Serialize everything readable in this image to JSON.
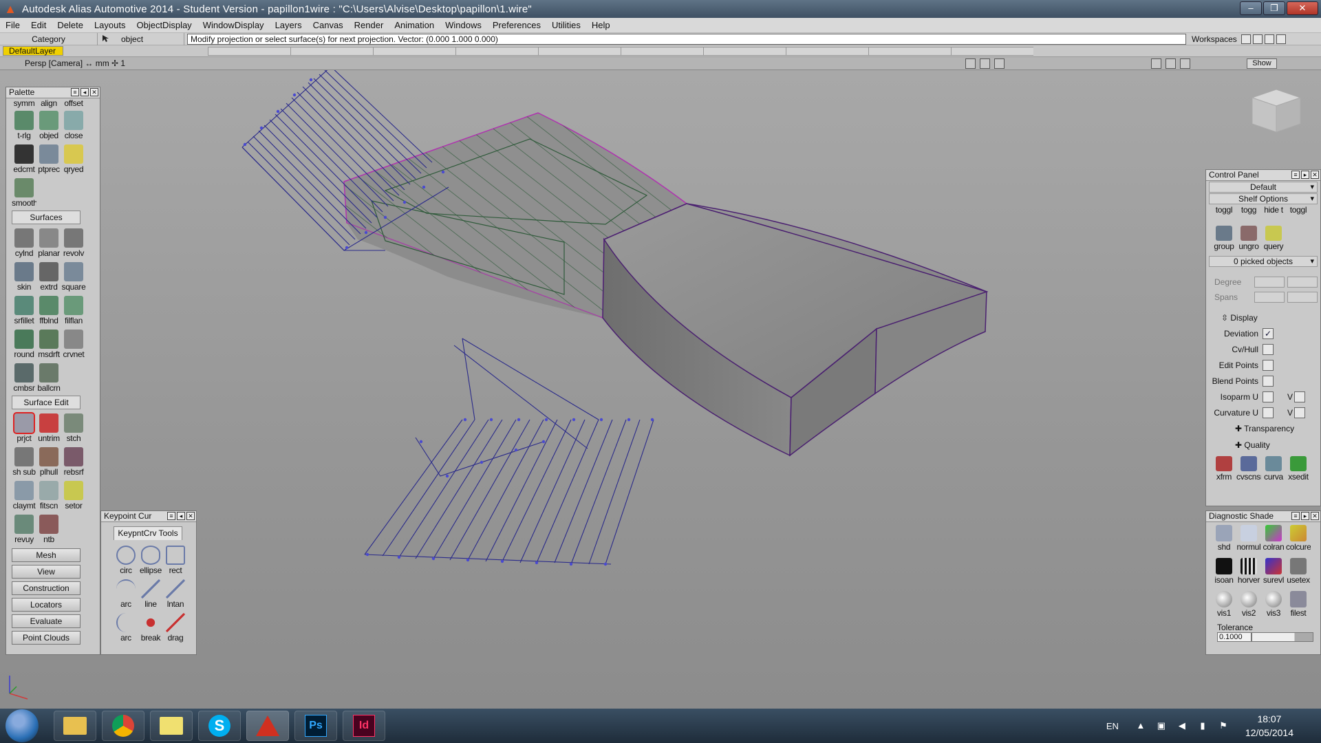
{
  "window": {
    "title": "Autodesk Alias Automotive 2014   - Student Version   - papillon1wire : \"C:\\Users\\Alvise\\Desktop\\papillon\\1.wire\"",
    "buttons": {
      "minimize": "–",
      "maximize": "❐",
      "close": "✕"
    }
  },
  "menu": [
    "File",
    "Edit",
    "Delete",
    "Layouts",
    "ObjectDisplay",
    "WindowDisplay",
    "Layers",
    "Canvas",
    "Render",
    "Animation",
    "Windows",
    "Preferences",
    "Utilities",
    "Help"
  ],
  "prompt": {
    "category": "Category",
    "object_mode": "object",
    "message": "Modify projection or select surface(s) for next projection.  Vector: (0.000 1.000 0.000)",
    "workspaces": "Workspaces"
  },
  "layers": {
    "default": "DefaultLayer"
  },
  "viewport": {
    "title": "Persp [Camera] ↔ mm  ✢ 1",
    "show_button": "Show"
  },
  "palette": {
    "title": "Palette",
    "top_labels": [
      "symm",
      "align",
      "offset"
    ],
    "top_tools": [
      "t-rlg",
      "objed",
      "close",
      "edcmt",
      "ptprec",
      "qryed",
      "smooth"
    ],
    "surfaces_tab": "Surfaces",
    "surfaces_tools": [
      "cylnd",
      "planar",
      "revolv",
      "skin",
      "extrd",
      "square",
      "srfillet",
      "ffblnd",
      "filflan",
      "round",
      "msdrft",
      "crvnet",
      "cmbsr",
      "ballcrn"
    ],
    "surface_edit_tab": "Surface Edit",
    "surface_edit_tools": [
      "prjct",
      "untrim",
      "stch",
      "sh sub",
      "plhull",
      "rebsrf",
      "claymt",
      "fitscn",
      "setor",
      "revuy",
      "ntb"
    ],
    "buttons": [
      "Mesh",
      "View",
      "Construction",
      "Locators",
      "Evaluate",
      "Point Clouds"
    ]
  },
  "keypoint": {
    "title": "Keypoint Cur",
    "tab": "KeypntCrv Tools",
    "tools": [
      "circ",
      "ellipse",
      "rect",
      "arc",
      "line",
      "lntan",
      "arc",
      "break",
      "drag"
    ]
  },
  "control_panel": {
    "title": "Control Panel",
    "default": "Default",
    "shelf_options": "Shelf Options",
    "shelf_tools": [
      "toggl",
      "togg",
      "hide t",
      "toggl",
      "group",
      "ungro",
      "query"
    ],
    "picked": "0 picked objects",
    "degree": "Degree",
    "spans": "Spans",
    "display": "Display",
    "rows": [
      {
        "label": "Deviation",
        "checked": "✓"
      },
      {
        "label": "Cv/Hull",
        "checked": ""
      },
      {
        "label": "Edit Points",
        "checked": ""
      },
      {
        "label": "Blend Points",
        "checked": ""
      },
      {
        "label": "Isoparm U",
        "checked": "",
        "v": "V"
      },
      {
        "label": "Curvature U",
        "checked": "",
        "v": "V"
      }
    ],
    "transparency": "Transparency",
    "quality": "Quality",
    "bottom_tools": [
      "xfrm",
      "cvscnsrf",
      "curva",
      "xsedit"
    ]
  },
  "diagnostic": {
    "title": "Diagnostic Shade",
    "tools": [
      "shd",
      "normul",
      "colran",
      "colcurevl",
      "isoan",
      "horver",
      "surevl",
      "usetex",
      "vis1",
      "vis2",
      "vis3",
      "filest"
    ],
    "tolerance_label": "Tolerance",
    "tolerance_value": "0.1000"
  },
  "taskbar": {
    "lang": "EN",
    "time": "18:07",
    "date": "12/05/2014"
  },
  "colors": {
    "surface": "#8a8a8a",
    "surface_edge": "#6a2a7a",
    "wire": "#2a2a8a",
    "hatch": "#2f5a3a",
    "layer": "#f0d000"
  }
}
